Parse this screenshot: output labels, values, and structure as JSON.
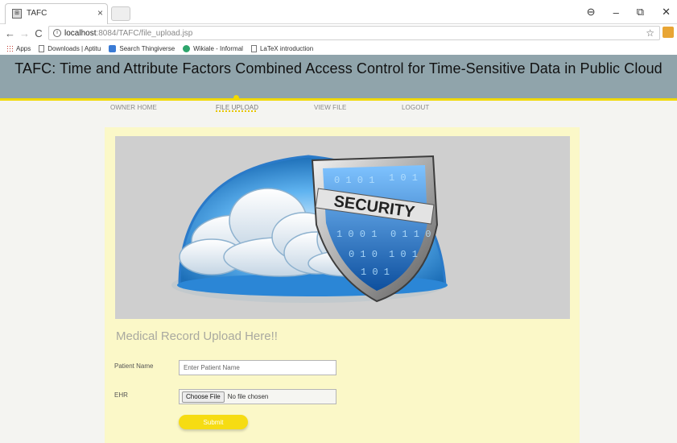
{
  "browser": {
    "tab_title": "TAFC",
    "url_host": "localhost",
    "url_path": ":8084/TAFC/file_upload.jsp",
    "bookmarks": [
      "Apps",
      "Downloads | Aptitu",
      "Search Thingiverse",
      "Wikiale - Informal",
      "LaTeX introduction"
    ]
  },
  "header": {
    "title": "TAFC: Time and Attribute Factors Combined Access Control for Time-Sensitive Data in Public Cloud"
  },
  "nav": {
    "items": [
      "OWNER HOME",
      "FILE UPLOAD",
      "VIEW FILE",
      "LOGOUT"
    ],
    "active": "FILE UPLOAD"
  },
  "hero": {
    "shield_text": "SECURITY"
  },
  "form": {
    "title": "Medical Record Upload Here!!",
    "patient_label": "Patient Name",
    "patient_placeholder": "Enter Patient Name",
    "ehr_label": "EHR",
    "file_button": "Choose File",
    "file_status": "No file chosen",
    "submit_label": "Submit"
  },
  "colors": {
    "header_bg": "#90a4ab",
    "accent": "#f1d900",
    "panel_bg": "#fbf8c8"
  }
}
